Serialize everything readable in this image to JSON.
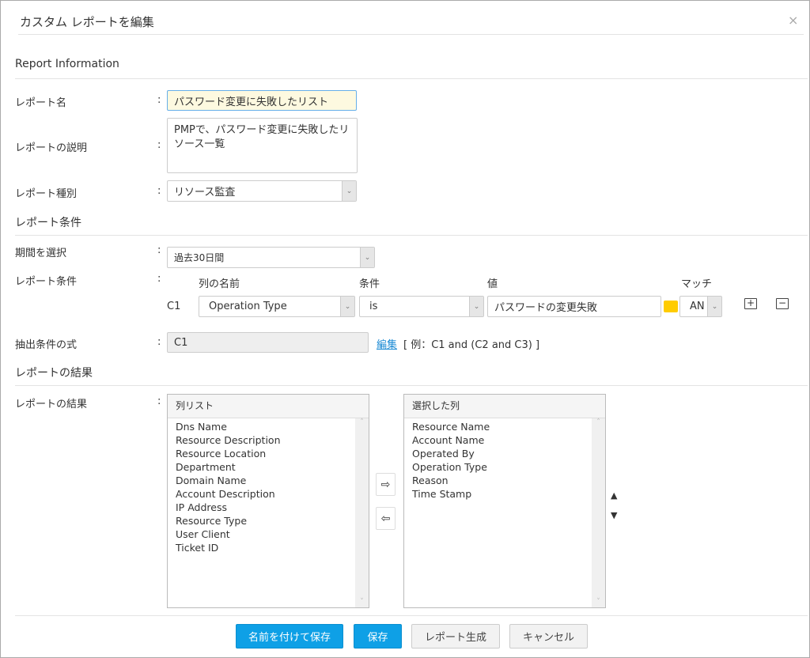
{
  "dialog": {
    "title": "カスタム レポートを編集",
    "close": "×"
  },
  "report_info": {
    "heading": "Report Information",
    "name_label": "レポート名",
    "name_value": "パスワード変更に失敗したリスト",
    "desc_label": "レポートの説明",
    "desc_value": "PMPで、パスワード変更に失敗したリソース一覧",
    "type_label": "レポート種別",
    "type_value": "リソース監査"
  },
  "conditions": {
    "heading": "レポート条件",
    "period_label": "期間を選択",
    "period_value": "過去30日間",
    "cond_label": "レポート条件",
    "col_header": "列の名前",
    "op_header": "条件",
    "value_header": "値",
    "match_header": "マッチ",
    "row": {
      "id": "C1",
      "column": "Operation Type",
      "operator": "is",
      "value": "パスワードの変更失敗",
      "match": "AN"
    },
    "expr_label": "抽出条件の式",
    "expr_value": "C1",
    "edit_link": "編集",
    "example": "[ 例：C1 and (C2 and C3) ]"
  },
  "results": {
    "heading": "レポートの結果",
    "label": "レポートの結果",
    "available_header": "列リスト",
    "available": [
      "Dns Name",
      "Resource Description",
      "Resource Location",
      "Department",
      "Domain Name",
      "Account Description",
      "IP Address",
      "Resource Type",
      "User Client",
      "Ticket ID"
    ],
    "selected_header": "選択した列",
    "selected": [
      "Resource Name",
      "Account Name",
      "Operated By",
      "Operation Type",
      "Reason",
      "Time Stamp"
    ]
  },
  "footer": {
    "save_as": "名前を付けて保存",
    "save": "保存",
    "generate": "レポート生成",
    "cancel": "キャンセル"
  },
  "colors": {
    "primary": "#0ea0e6",
    "name_bg": "#fdf9e0"
  }
}
